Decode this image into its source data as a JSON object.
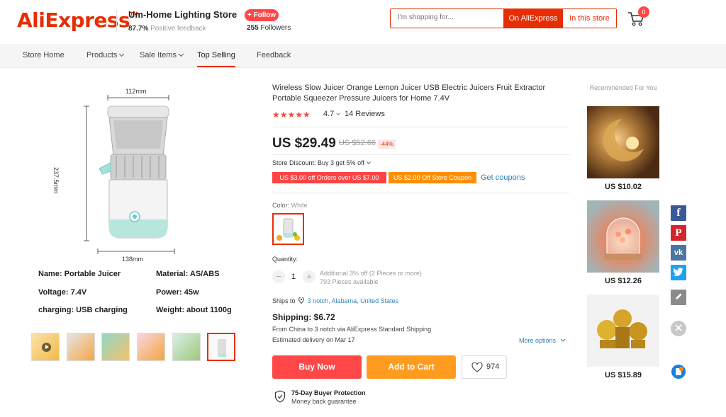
{
  "header": {
    "logo": "AliExpress",
    "logo_tm": "TM",
    "store_name": "Um-Home Lighting Store",
    "feedback_pct": "87.7%",
    "feedback_label": "Positive feedback",
    "follow_label": "+ Follow",
    "followers_count": "255",
    "followers_label": "Followers",
    "search_placeholder": "I'm shopping for...",
    "search_ae": "On AliExpress",
    "search_store": "In this store",
    "cart_count": "0"
  },
  "nav": {
    "items": [
      "Store Home",
      "Products",
      "Sale Items",
      "Top Selling",
      "Feedback"
    ],
    "active": "Top Selling"
  },
  "gallery": {
    "dim_top": "112mm",
    "dim_side": "237.5mm",
    "dim_bottom": "138mm",
    "specs": [
      "Name: Portable Juicer",
      "Material: AS/ABS",
      "Voltage: 7.4V",
      "Power: 45w",
      "charging: USB charging",
      "Weight: about 1100g"
    ],
    "thumb_count": 6,
    "selected_thumb": 6
  },
  "product": {
    "title": "Wireless Slow Juicer Orange Lemon Juicer USB Electric Juicers Fruit Extractor Portable Squeezer Pressure Juicers for Home 7.4V",
    "stars": "★★★★★",
    "rating": "4.7",
    "reviews": "14 Reviews",
    "price": "US $29.49",
    "old_price": "US $52.66",
    "discount": "-44%",
    "store_discount": "Store Discount: Buy 3 get 5% off",
    "coupon1": "US $3.00 off Orders over US $7.00",
    "coupon2": "US $2.00 Off Store Coupon",
    "get_coupons": "Get coupons",
    "color_label": "Color:",
    "color_value": "White",
    "quantity_label": "Quantity:",
    "quantity": "1",
    "qty_info1": "Additional 3% off (2 Pieces or more)",
    "qty_info2": "793 Pieces available",
    "ships_to_label": "Ships to",
    "ships_to_value": "3 notch, Alabama, United States",
    "shipping": "Shipping: $6.72",
    "ship_from": "From China to 3 notch via AliExpress Standard Shipping",
    "delivery": "Estimated delivery on Mar 17",
    "more_options": "More options",
    "buy_now": "Buy Now",
    "add_to_cart": "Add to Cart",
    "wishlist_count": "974",
    "protection_title": "75-Day Buyer Protection",
    "protection_sub": "Money back guarantee"
  },
  "recommended": {
    "title": "Recommended For You",
    "items": [
      {
        "price": "US $10.02"
      },
      {
        "price": "US $12.26"
      },
      {
        "price": "US $15.89"
      }
    ]
  },
  "social": {
    "facebook": "f",
    "pinterest": "P",
    "vk": "vk"
  },
  "colors": {
    "brand": "#e62e04",
    "buy": "#ff4747",
    "cart": "#ff9b1f",
    "link": "#2d80b8"
  }
}
